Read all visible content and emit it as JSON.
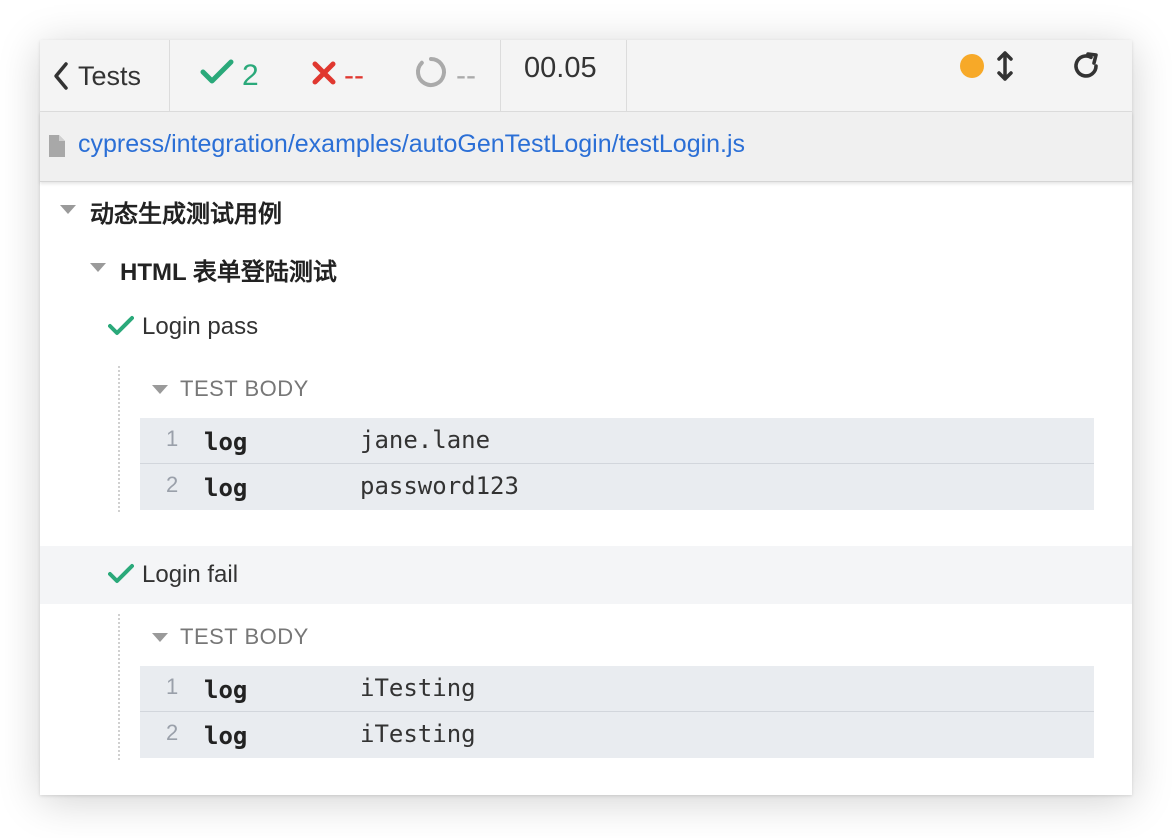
{
  "header": {
    "back_label": "Tests",
    "passed": "2",
    "failed": "--",
    "pending": "--",
    "duration": "00.05",
    "status_color": "#f7a928"
  },
  "spec": {
    "path": "cypress/integration/examples/autoGenTestLogin/testLogin.js"
  },
  "suites": {
    "root": {
      "title": "动态生成测试用例"
    },
    "child": {
      "title": "HTML 表单登陆测试"
    }
  },
  "tests": [
    {
      "title": "Login pass",
      "state": "passed",
      "body_label": "TEST BODY",
      "commands": [
        {
          "num": "1",
          "name": "log",
          "message": "jane.lane"
        },
        {
          "num": "2",
          "name": "log",
          "message": "password123"
        }
      ]
    },
    {
      "title": "Login fail",
      "state": "passed",
      "body_label": "TEST BODY",
      "commands": [
        {
          "num": "1",
          "name": "log",
          "message": "iTesting"
        },
        {
          "num": "2",
          "name": "log",
          "message": "iTesting"
        }
      ]
    }
  ],
  "icons": {
    "back": "chevron-left-icon",
    "pass": "check-icon",
    "fail": "x-icon",
    "pending": "circle-notch-icon",
    "scroll": "arrows-vertical-icon",
    "reload": "reload-icon",
    "file": "file-icon"
  },
  "colors": {
    "pass": "#2aa97a",
    "fail": "#e0372f",
    "link": "#2b6fd6"
  }
}
